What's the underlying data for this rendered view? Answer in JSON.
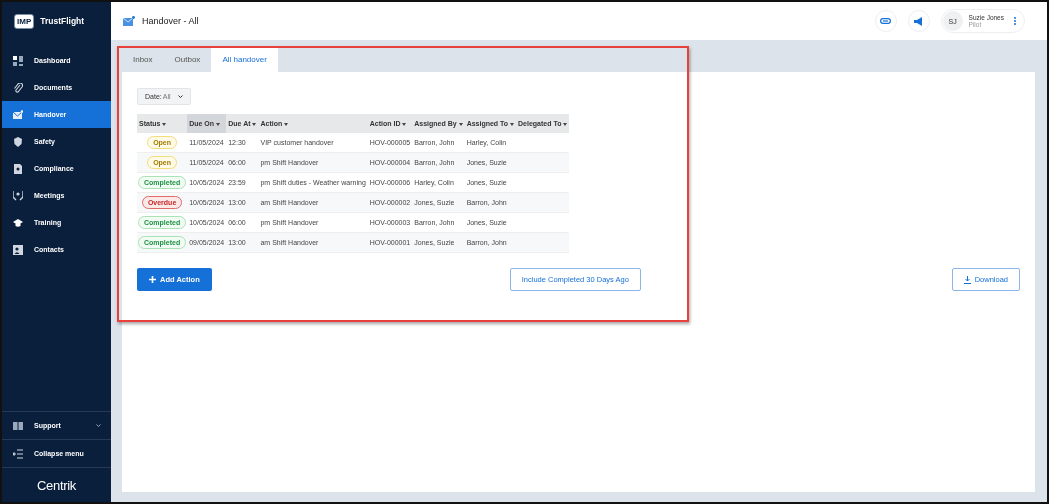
{
  "brand": {
    "badge": "IMP",
    "name": "TrustFlight"
  },
  "sidebar": {
    "items": [
      {
        "label": "Dashboard",
        "selected": false
      },
      {
        "label": "Documents",
        "selected": false
      },
      {
        "label": "Handover",
        "selected": true
      },
      {
        "label": "Safety",
        "selected": false
      },
      {
        "label": "Compliance",
        "selected": false
      },
      {
        "label": "Meetings",
        "selected": false
      },
      {
        "label": "Training",
        "selected": false
      },
      {
        "label": "Contacts",
        "selected": false
      }
    ],
    "footer": [
      {
        "label": "Support",
        "kind": "dropdown"
      },
      {
        "label": "Collapse menu",
        "kind": "action"
      }
    ],
    "logo": "Centrik"
  },
  "header": {
    "title": "Handover - All",
    "user": {
      "initials": "SJ",
      "name": "Suzie Jones",
      "role": "Pilot"
    }
  },
  "tabs": [
    {
      "label": "Inbox",
      "selected": false
    },
    {
      "label": "Outbox",
      "selected": false
    },
    {
      "label": "All handover",
      "selected": true
    }
  ],
  "filter": {
    "label": "Date:",
    "value": "All"
  },
  "table": {
    "columns": [
      {
        "label": "Status",
        "sorted": false
      },
      {
        "label": "Due On",
        "sorted": true
      },
      {
        "label": "Due At",
        "sorted": false
      },
      {
        "label": "Action",
        "sorted": false
      },
      {
        "label": "Action ID",
        "sorted": false
      },
      {
        "label": "Assigned By",
        "sorted": false
      },
      {
        "label": "Assigned To",
        "sorted": false
      },
      {
        "label": "Delegated To",
        "sorted": false
      }
    ],
    "rows": [
      {
        "kind": "open",
        "cells": [
          "Open",
          "11/05/2024",
          "12:30",
          "VIP customer handover",
          "HOV-000005",
          "Barron, John",
          "Harley, Colin"
        ]
      },
      {
        "kind": "open",
        "cells": [
          "Open",
          "11/05/2024",
          "06:00",
          "pm Shift Handover",
          "HOV-000004",
          "Barron, John",
          "Jones, Suzie"
        ]
      },
      {
        "kind": "completed",
        "cells": [
          "Completed",
          "10/05/2024",
          "23:59",
          "pm Shift duties - Weather warning",
          "HOV-000006",
          "Harley, Colin",
          "Jones, Suzie"
        ]
      },
      {
        "kind": "overdue",
        "cells": [
          "Overdue",
          "10/05/2024",
          "13:00",
          "am Shift Handover",
          "HOV-000002",
          "Jones, Suzie",
          "Barron, John"
        ]
      },
      {
        "kind": "completed",
        "cells": [
          "Completed",
          "10/05/2024",
          "06:00",
          "pm Shift Handover",
          "HOV-000003",
          "Barron, John",
          "Jones, Suzie"
        ]
      },
      {
        "kind": "completed",
        "cells": [
          "Completed",
          "09/05/2024",
          "13:00",
          "am Shift Handover",
          "HOV-000001",
          "Jones, Suzie",
          "Barron, John"
        ]
      }
    ]
  },
  "buttons": {
    "add": "Add Action",
    "include": "Include Completed 30 Days Ago",
    "download": "Download"
  },
  "annotation": {
    "highlight": true
  }
}
